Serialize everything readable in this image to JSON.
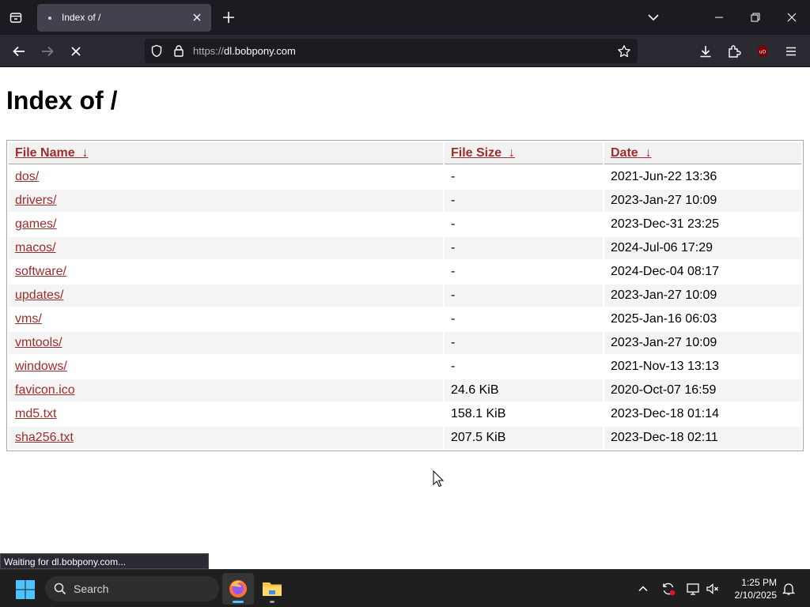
{
  "browser": {
    "tab_title": "Index of /",
    "url_prefix": "https://",
    "url_domain": "dl.bobpony.com",
    "status_text": "Waiting for dl.bobpony.com..."
  },
  "page": {
    "heading": "Index of /",
    "columns": [
      {
        "label": "File Name",
        "sort_arrow": "↓"
      },
      {
        "label": "File Size",
        "sort_arrow": "↓"
      },
      {
        "label": "Date",
        "sort_arrow": "↓"
      }
    ],
    "rows": [
      {
        "name": "dos/",
        "size": "-",
        "date": "2021-Jun-22 13:36"
      },
      {
        "name": "drivers/",
        "size": "-",
        "date": "2023-Jan-27 10:09"
      },
      {
        "name": "games/",
        "size": "-",
        "date": "2023-Dec-31 23:25"
      },
      {
        "name": "macos/",
        "size": "-",
        "date": "2024-Jul-06 17:29"
      },
      {
        "name": "software/",
        "size": "-",
        "date": "2024-Dec-04 08:17"
      },
      {
        "name": "updates/",
        "size": "-",
        "date": "2023-Jan-27 10:09"
      },
      {
        "name": "vms/",
        "size": "-",
        "date": "2025-Jan-16 06:03"
      },
      {
        "name": "vmtools/",
        "size": "-",
        "date": "2023-Jan-27 10:09"
      },
      {
        "name": "windows/",
        "size": "-",
        "date": "2021-Nov-13 13:13"
      },
      {
        "name": "favicon.ico",
        "size": "24.6 KiB",
        "date": "2020-Oct-07 16:59"
      },
      {
        "name": "md5.txt",
        "size": "158.1 KiB",
        "date": "2023-Dec-18 01:14"
      },
      {
        "name": "sha256.txt",
        "size": "207.5 KiB",
        "date": "2023-Dec-18 02:11"
      }
    ]
  },
  "taskbar": {
    "search_label": "Search",
    "time": "1:25 PM",
    "date": "2/10/2025"
  },
  "colors": {
    "link": "#9d2c2c",
    "chrome_dark": "#1c1b22",
    "taskbar": "#1f1f1f"
  }
}
